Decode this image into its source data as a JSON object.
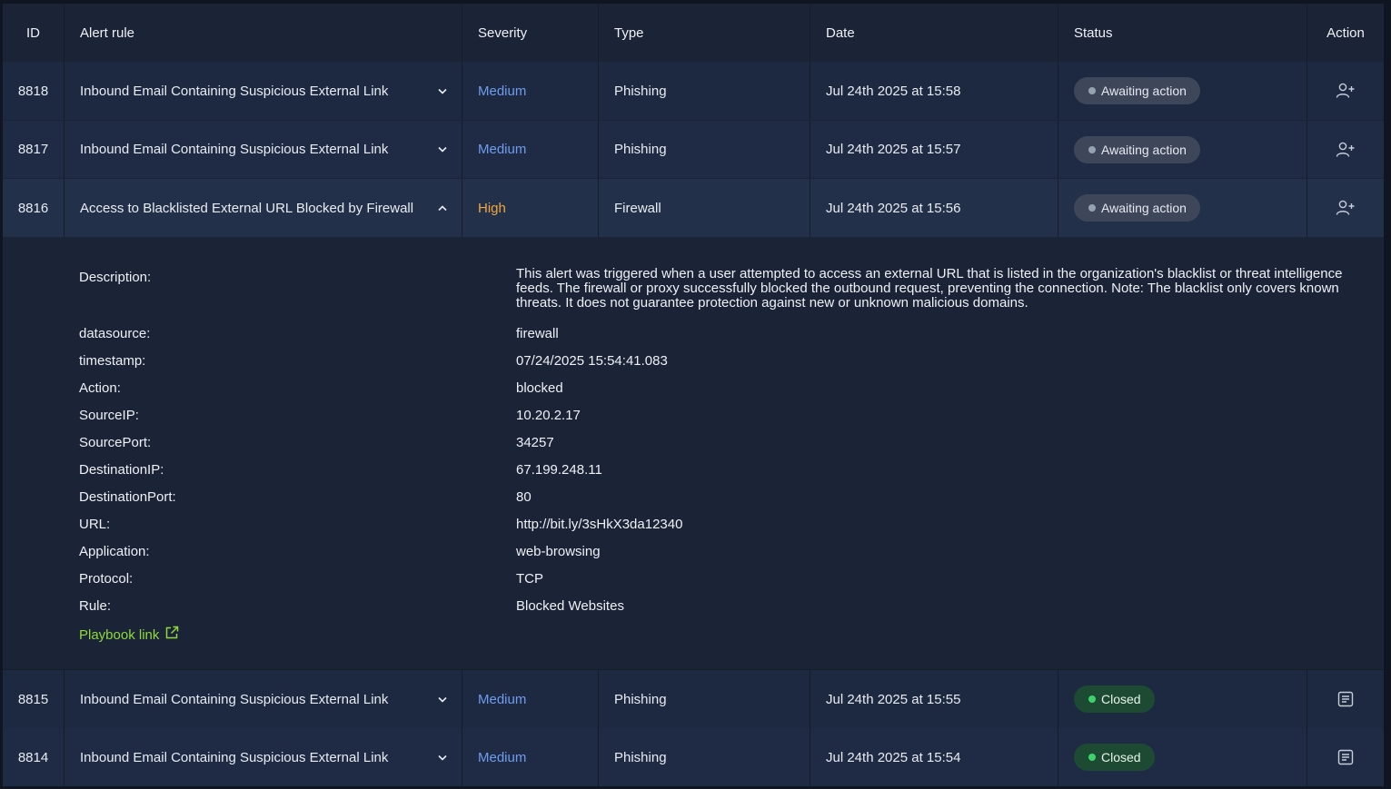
{
  "columns": {
    "id": "ID",
    "rule": "Alert rule",
    "severity": "Severity",
    "type": "Type",
    "date": "Date",
    "status": "Status",
    "action": "Action"
  },
  "rows": [
    {
      "id": "8818",
      "rule": "Inbound Email Containing Suspicious External Link",
      "severity": "Medium",
      "type": "Phishing",
      "date": "Jul 24th 2025 at 15:58",
      "status": "Awaiting action"
    },
    {
      "id": "8817",
      "rule": "Inbound Email Containing Suspicious External Link",
      "severity": "Medium",
      "type": "Phishing",
      "date": "Jul 24th 2025 at 15:57",
      "status": "Awaiting action"
    },
    {
      "id": "8816",
      "rule": "Access to Blacklisted External URL Blocked by Firewall",
      "severity": "High",
      "type": "Firewall",
      "date": "Jul 24th 2025 at 15:56",
      "status": "Awaiting action"
    },
    {
      "id": "8815",
      "rule": "Inbound Email Containing Suspicious External Link",
      "severity": "Medium",
      "type": "Phishing",
      "date": "Jul 24th 2025 at 15:55",
      "status": "Closed"
    },
    {
      "id": "8814",
      "rule": "Inbound Email Containing Suspicious External Link",
      "severity": "Medium",
      "type": "Phishing",
      "date": "Jul 24th 2025 at 15:54",
      "status": "Closed"
    }
  ],
  "details": {
    "description_label": "Description:",
    "description": "This alert was triggered when a user attempted to access an external URL that is listed in the organization's blacklist or threat intelligence feeds. The firewall or proxy successfully blocked the outbound request, preventing the connection. Note: The blacklist only covers known threats. It does not guarantee protection against new or unknown malicious domains.",
    "fields": [
      {
        "label": "datasource:",
        "value": "firewall"
      },
      {
        "label": "timestamp:",
        "value": "07/24/2025 15:54:41.083"
      },
      {
        "label": "Action:",
        "value": "blocked"
      },
      {
        "label": "SourceIP:",
        "value": "10.20.2.17"
      },
      {
        "label": "SourcePort:",
        "value": "34257"
      },
      {
        "label": "DestinationIP:",
        "value": "67.199.248.11"
      },
      {
        "label": "DestinationPort:",
        "value": "80"
      },
      {
        "label": "URL:",
        "value": "http://bit.ly/3sHkX3da12340"
      },
      {
        "label": "Application:",
        "value": "web-browsing"
      },
      {
        "label": "Protocol:",
        "value": "TCP"
      },
      {
        "label": "Rule:",
        "value": "Blocked Websites"
      }
    ],
    "playbook_label": "Playbook link"
  },
  "colors": {
    "medium": "#6f9cf0",
    "high": "#f0a640",
    "closed_dot": "#3ed36a",
    "playbook": "#8fd93c"
  }
}
